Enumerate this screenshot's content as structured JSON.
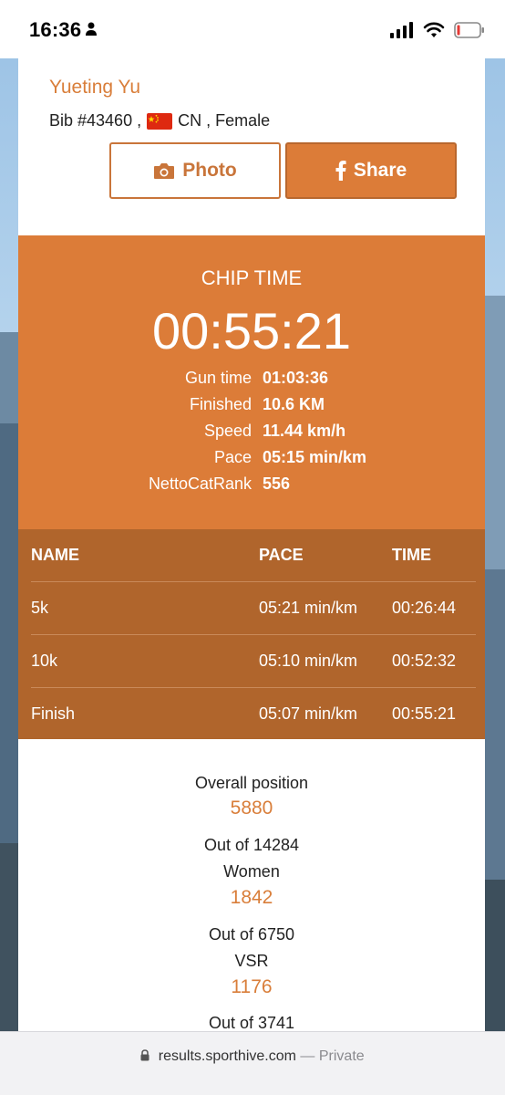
{
  "status_bar": {
    "time": "16:36"
  },
  "runner": {
    "name": "Yueting Yu",
    "bib": "Bib #43460 ,",
    "country_gender": "CN , Female"
  },
  "buttons": {
    "photo": "Photo",
    "share": "Share"
  },
  "chip": {
    "label": "CHIP TIME",
    "value": "00:55:21",
    "stats": [
      {
        "label": "Gun time",
        "value": "01:03:36"
      },
      {
        "label": "Finished",
        "value": "10.6 KM"
      },
      {
        "label": "Speed",
        "value": "11.44 km/h"
      },
      {
        "label": "Pace",
        "value": "05:15 min/km"
      },
      {
        "label": "NettoCatRank",
        "value": "556"
      }
    ]
  },
  "splits": {
    "headers": [
      "NAME",
      "PACE",
      "TIME"
    ],
    "rows": [
      {
        "name": "5k",
        "pace": "05:21 min/km",
        "time": "00:26:44"
      },
      {
        "name": "10k",
        "pace": "05:10 min/km",
        "time": "00:52:32"
      },
      {
        "name": "Finish",
        "pace": "05:07 min/km",
        "time": "00:55:21"
      }
    ]
  },
  "positions": {
    "overall_label": "Overall position",
    "overall_value": "5880",
    "overall_out": "Out of 14284",
    "women_label": "Women",
    "women_value": "1842",
    "women_out": "Out of 6750",
    "vsr_label": "VSR",
    "vsr_value": "1176",
    "vsr_out": "Out of 3741"
  },
  "url_bar": {
    "domain": "results.sporthive.com",
    "separator": "—",
    "mode": "Private"
  },
  "colors": {
    "accent": "#dc7c38",
    "accent_dark": "#b0652c",
    "text_orange": "#d97e3a"
  }
}
